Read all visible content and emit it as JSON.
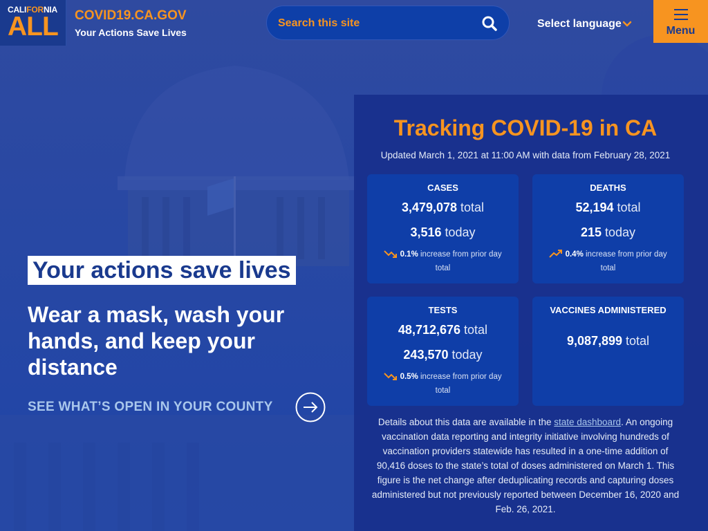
{
  "header": {
    "logo_top_a": "CALI",
    "logo_top_for": "FOR",
    "logo_top_b": "NIA",
    "logo_bottom": "ALL",
    "site_title": "COVID19.CA.GOV",
    "tagline": "Your Actions Save Lives",
    "search_placeholder": "Search this site",
    "language_label": "Select language",
    "menu_label": "Menu"
  },
  "hero": {
    "title": "Your actions save lives",
    "subtitle": "Wear a mask, wash your hands, and keep your distance",
    "link_label": "SEE WHAT’S OPEN IN YOUR COUNTY"
  },
  "tracking": {
    "title": "Tracking COVID-19 in CA",
    "updated": "Updated March 1, 2021 at 11:00 AM with data from February 28, 2021",
    "total_word": "total",
    "today_word": "today",
    "cards": {
      "cases": {
        "heading": "CASES",
        "total": "3,479,078",
        "today": "3,516",
        "change_pct": "0.1%",
        "change_text": "increase from prior day total",
        "trend": "down"
      },
      "deaths": {
        "heading": "DEATHS",
        "total": "52,194",
        "today": "215",
        "change_pct": "0.4%",
        "change_text": "increase from prior day total",
        "trend": "up"
      },
      "tests": {
        "heading": "TESTS",
        "total": "48,712,676",
        "today": "243,570",
        "change_pct": "0.5%",
        "change_text": "increase from prior day total",
        "trend": "down"
      },
      "vaccines": {
        "heading": "VACCINES ADMINISTERED",
        "total": "9,087,899"
      }
    },
    "details_before": "Details about this data are available in the ",
    "details_link": "state dashboard",
    "details_after": ". An ongoing vaccination data reporting and integrity initiative involving hundreds of vaccination providers statewide has resulted in a one-time addition of 90,416 doses to the state’s total of doses administered on March 1. This figure is the net change after deduplicating records and capturing doses administered but not previously reported between December 16, 2020 and Feb. 26, 2021."
  },
  "colors": {
    "brand_orange": "#f79420",
    "brand_blue": "#1a3a8e",
    "card_blue": "#0f3ea8"
  },
  "icons": [
    "search-icon",
    "chevron-down-icon",
    "menu-icon",
    "arrow-right-circle-icon",
    "trend-down-icon",
    "trend-up-icon"
  ]
}
